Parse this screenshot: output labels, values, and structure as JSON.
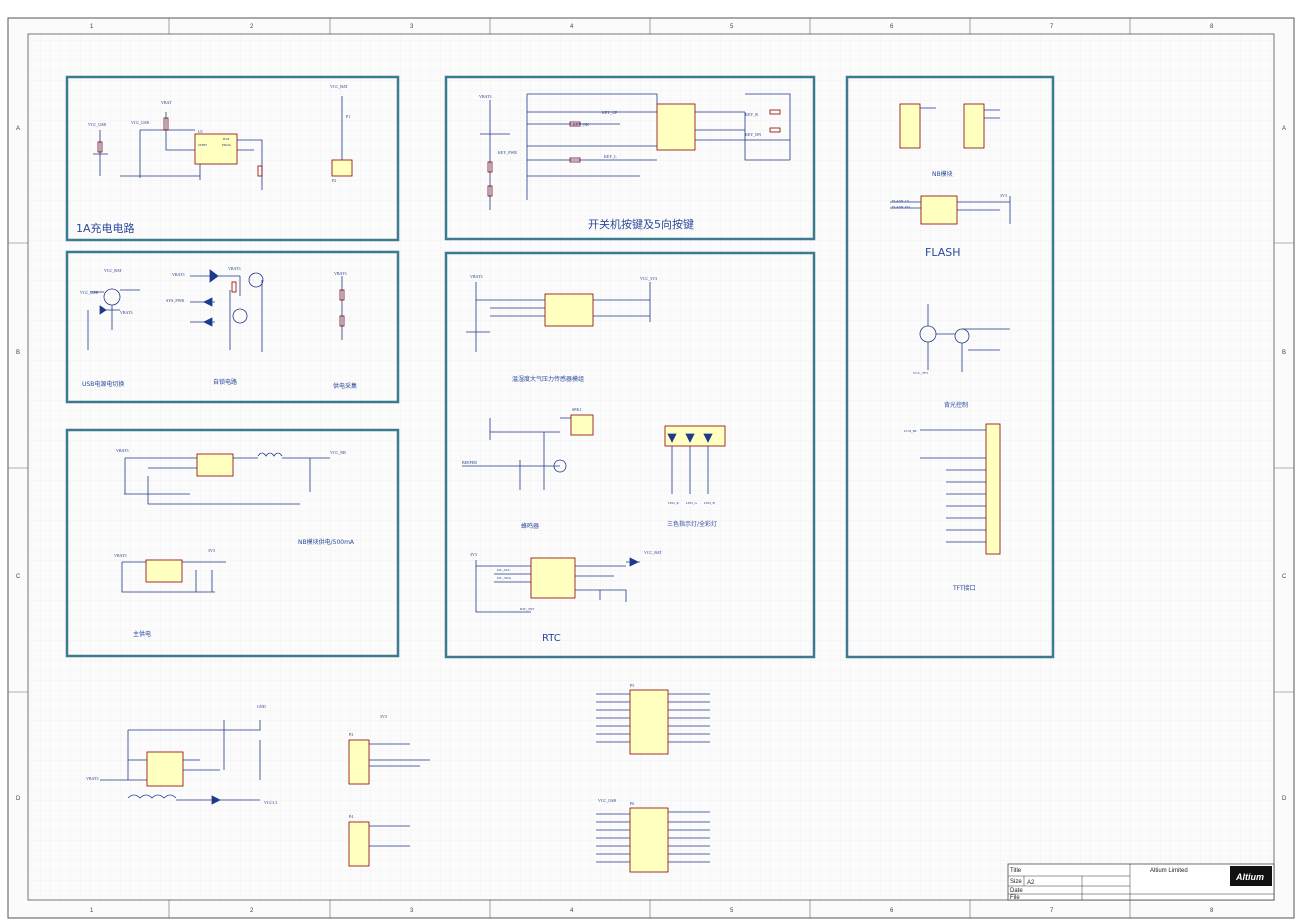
{
  "colors": {
    "frame": "#3b7a8f",
    "wire": "#1f3a8a",
    "power": "#8b0000",
    "grid": "#e8e8e8",
    "component": "#ffffc0"
  },
  "border": {
    "columns": [
      "1",
      "2",
      "3",
      "4",
      "5",
      "6",
      "7",
      "8"
    ],
    "rows": [
      "A",
      "B",
      "C",
      "D"
    ]
  },
  "sections": {
    "charge": {
      "title": "1A充电电路",
      "nets": [
        "VCC_USB",
        "VCC_USB",
        "VBAT",
        "VCC_BAT",
        "BAT",
        "PROG",
        "SDHT"
      ],
      "ics": [
        "U1",
        "P1",
        "P2"
      ]
    },
    "power_select": {
      "usb_label": "USB电源电切换",
      "auto_label": "自锁电路",
      "battery_label": "供电采集",
      "nets": [
        "VCC_BAT",
        "VCC_USB",
        "VBAT3",
        "VBAT3",
        "VBAT3",
        "SYS_PWR",
        "VBAT3"
      ]
    },
    "supply": {
      "nb_label": "NB模块供电/500mA",
      "main_label": "主供电",
      "nets": [
        "VBAT3",
        "VCC_NB",
        "VBAT3",
        "3V3"
      ]
    },
    "keys": {
      "title": "开关机按键及5向按键",
      "nets": [
        "VBAT3",
        "KEY_UP",
        "KEY_OK",
        "KEY_L",
        "KEY_R",
        "KEY_DN",
        "KEY_PWR"
      ]
    },
    "sensor": {
      "title": "温湿度大气压力传感器模组",
      "label2": "蜂鸣器",
      "label3": "三色指示灯/全彩灯",
      "nets": [
        "VBAT3",
        "VCC_3V3",
        "SPK1",
        "BEEPER",
        "LED_R",
        "LED_G",
        "LED_B"
      ]
    },
    "rtc": {
      "title": "RTC",
      "nets": [
        "3V3",
        "I2C_SCL",
        "I2C_SDA",
        "RTC_INT",
        "VCC_BAT"
      ]
    },
    "right": {
      "nb_label": "NB模块",
      "flash_label": "FLASH",
      "backlight_label": "背光控制",
      "tft_label": "TFT接口",
      "nets": [
        "FLASH_CS",
        "FLASH_DO",
        "LCD_BL",
        "VCC_TFT",
        "3V3"
      ]
    },
    "bottom": {
      "nets": [
        "VBAT3",
        "GND",
        "3V3",
        "VCC_USB",
        "VCC3.3"
      ],
      "conn_labels": [
        "P3",
        "P4",
        "P5",
        "P6"
      ]
    }
  },
  "title_block": {
    "title_label": "Title",
    "size_label": "Size",
    "size_value": "A2",
    "date_label": "Date",
    "file_label": "File",
    "logo_text": "Altium",
    "company": "Altium Limited"
  }
}
